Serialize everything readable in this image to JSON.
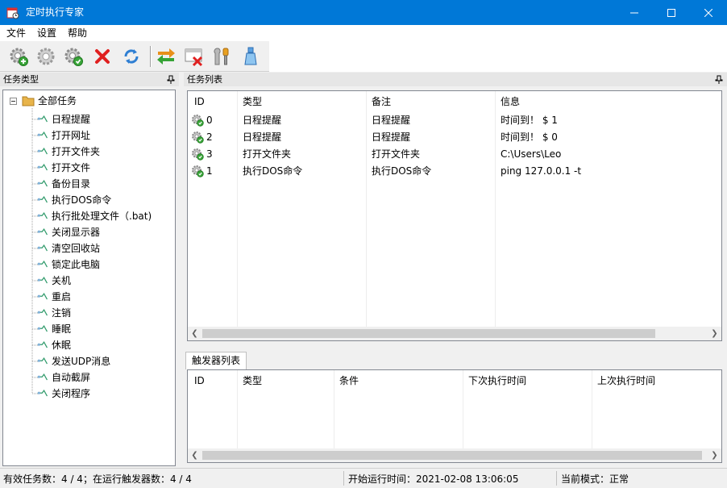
{
  "window": {
    "title": "定时执行专家"
  },
  "menu": [
    "文件",
    "设置",
    "帮助"
  ],
  "toolbar": {
    "buttons": [
      {
        "icon": "gear-add-icon"
      },
      {
        "icon": "gear-icon"
      },
      {
        "icon": "gear-check-icon"
      },
      {
        "icon": "delete-x-icon"
      },
      {
        "icon": "refresh-icon"
      },
      {
        "icon": "swap-arrows-icon"
      },
      {
        "icon": "window-delete-icon"
      },
      {
        "icon": "tools-icon"
      },
      {
        "icon": "bottle-icon"
      }
    ]
  },
  "left_panel": {
    "title": "任务类型",
    "root": "全部任务",
    "items": [
      "日程提醒",
      "打开网址",
      "打开文件夹",
      "打开文件",
      "备份目录",
      "执行DOS命令",
      "执行批处理文件（.bat)",
      "关闭显示器",
      "清空回收站",
      "锁定此电脑",
      "关机",
      "重启",
      "注销",
      "睡眠",
      "休眠",
      "发送UDP消息",
      "自动截屏",
      "关闭程序"
    ]
  },
  "task_panel": {
    "title": "任务列表",
    "columns": [
      "ID",
      "类型",
      "备注",
      "信息"
    ],
    "rows": [
      {
        "id": "0",
        "type": "日程提醒",
        "note": "日程提醒",
        "info": "时间到！ $ 1"
      },
      {
        "id": "2",
        "type": "日程提醒",
        "note": "日程提醒",
        "info": "时间到！ $ 0"
      },
      {
        "id": "3",
        "type": "打开文件夹",
        "note": "打开文件夹",
        "info": "C:\\Users\\Leo"
      },
      {
        "id": "1",
        "type": "执行DOS命令",
        "note": "执行DOS命令",
        "info": "ping 127.0.0.1 -t"
      }
    ]
  },
  "trigger_panel": {
    "tab": "触发器列表",
    "columns": [
      "ID",
      "类型",
      "条件",
      "下次执行时间",
      "上次执行时间"
    ]
  },
  "status": {
    "counts": "有效任务数：4 / 4；在运行触发器数：4 / 4",
    "start_time": "开始运行时间：2021-02-08 13:06:05",
    "mode": "当前模式：正常"
  },
  "colors": {
    "titlebar": "#0078d7",
    "delete": "#e02020",
    "folder": "#e8b44a"
  }
}
